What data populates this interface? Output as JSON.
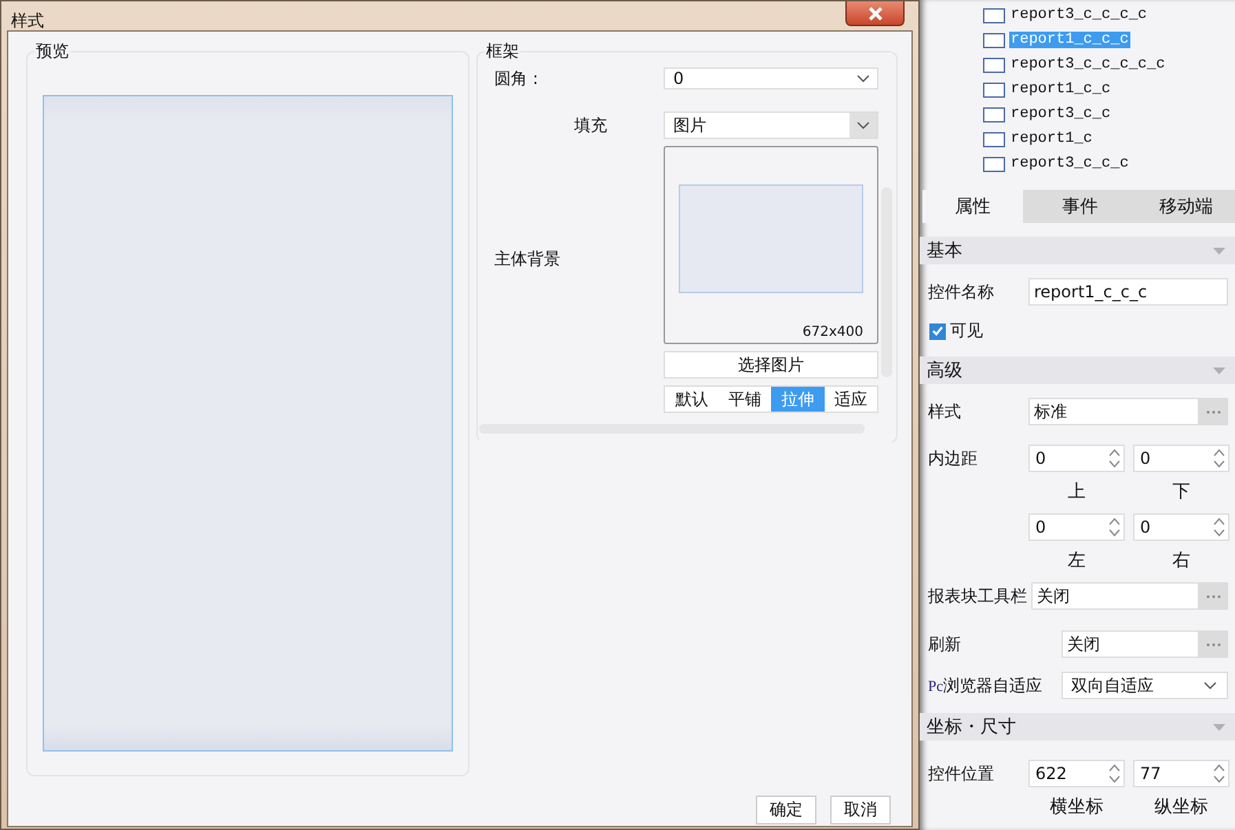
{
  "dialog": {
    "title": "样式",
    "preview": {
      "label": "预览"
    },
    "frame": {
      "label": "框架",
      "corner": {
        "label": "圆角 :",
        "value": "0"
      },
      "fill": {
        "label": "填充",
        "value": "图片"
      },
      "background": {
        "label": "主体背景",
        "size": "672x400",
        "choose_button": "选择图片",
        "modes": [
          {
            "label": "默认",
            "selected": false
          },
          {
            "label": "平铺",
            "selected": false
          },
          {
            "label": "拉伸",
            "selected": true
          },
          {
            "label": "适应",
            "selected": false
          }
        ]
      }
    },
    "buttons": [
      "确定",
      "取消"
    ]
  },
  "tree": [
    {
      "label": "report3_c_c_c_c",
      "selected": false
    },
    {
      "label": "report1_c_c_c",
      "selected": true
    },
    {
      "label": "report3_c_c_c_c_c",
      "selected": false
    },
    {
      "label": "report1_c_c",
      "selected": false
    },
    {
      "label": "report3_c_c",
      "selected": false
    },
    {
      "label": "report1_c",
      "selected": false
    },
    {
      "label": "report3_c_c_c",
      "selected": false
    }
  ],
  "tabs": [
    {
      "label": "属性",
      "selected": true
    },
    {
      "label": "事件",
      "selected": false
    },
    {
      "label": "移动端",
      "selected": false
    }
  ],
  "basic": {
    "title": "基本",
    "name_label": "控件名称",
    "name_value": "report1_c_c_c",
    "visible": {
      "label": "可见",
      "checked": true
    }
  },
  "advanced": {
    "title": "高级",
    "style_label": "样式",
    "style_value": "标准",
    "padding_label": "内边距",
    "padding": [
      {
        "value": "0",
        "caption": "上"
      },
      {
        "value": "0",
        "caption": "下"
      },
      {
        "value": "0",
        "caption": "左"
      },
      {
        "value": "0",
        "caption": "右"
      }
    ],
    "toolbar_label": "报表块工具栏",
    "toolbar_value": "关闭",
    "refresh_label": "刷新",
    "refresh_value": "关闭",
    "adapt_label_prefix": "Pc",
    "adapt_label": "浏览器自适应",
    "adapt_value": "双向自适应"
  },
  "position": {
    "title": "坐标・尺寸",
    "label": "控件位置",
    "fields": [
      {
        "value": "622",
        "caption": "横坐标"
      },
      {
        "value": "77",
        "caption": "纵坐标"
      }
    ]
  }
}
